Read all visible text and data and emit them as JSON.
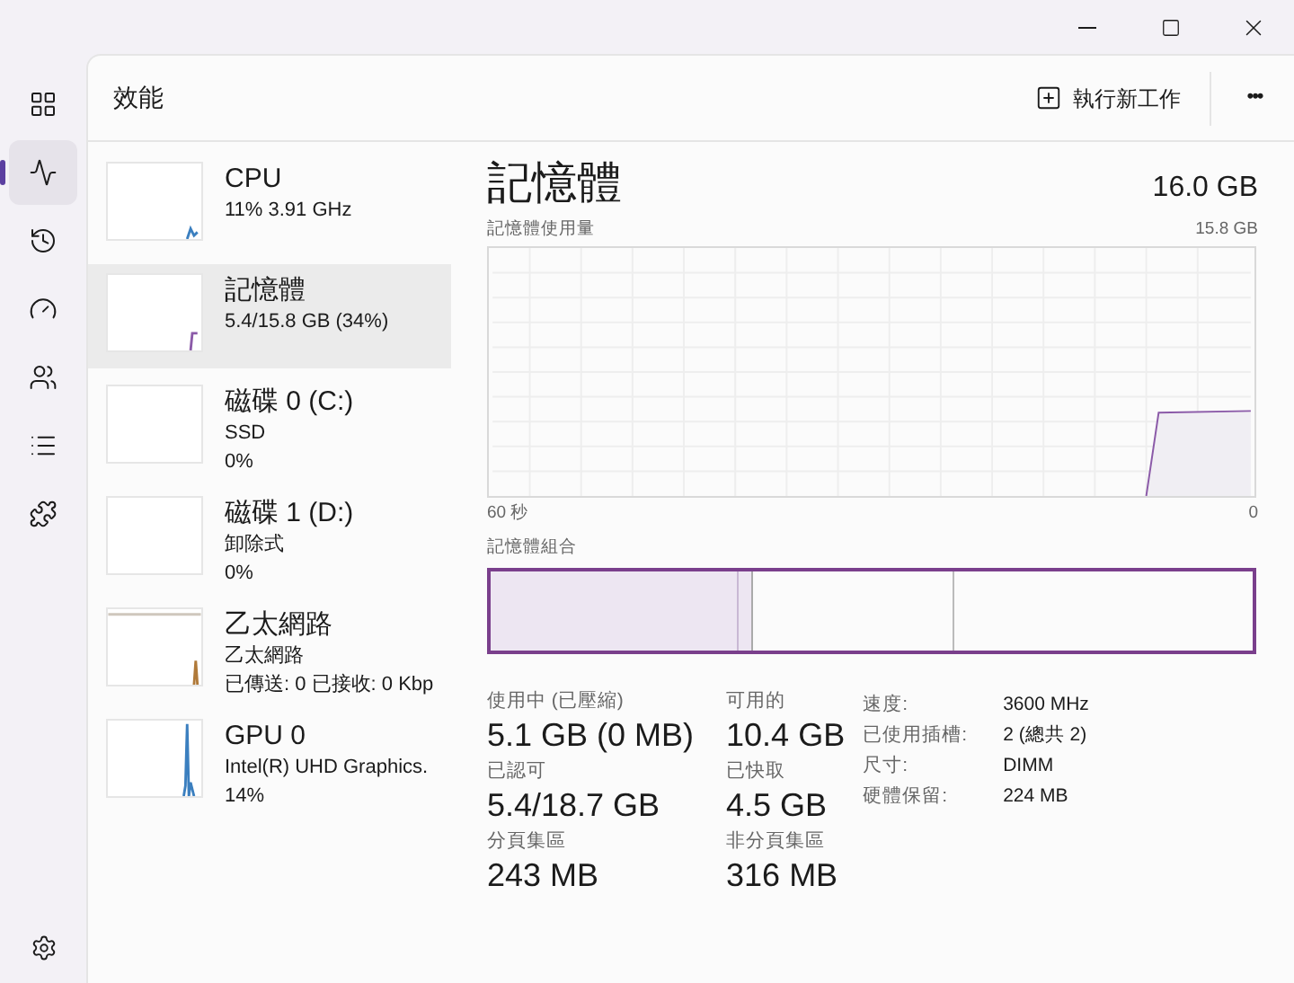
{
  "nav": [
    {
      "kind": "processes",
      "selected": false
    },
    {
      "kind": "performance",
      "selected": true
    },
    {
      "kind": "history",
      "selected": false
    },
    {
      "kind": "startup",
      "selected": false
    },
    {
      "kind": "users",
      "selected": false
    },
    {
      "kind": "details",
      "selected": false
    },
    {
      "kind": "services",
      "selected": false
    }
  ],
  "header": {
    "title": "效能",
    "run_task": "執行新工作",
    "more": "•••"
  },
  "devices": [
    {
      "name": "CPU",
      "lines": [
        "11%  3.91 GHz"
      ],
      "selected": false,
      "color": "#3b7fbf"
    },
    {
      "name": "記憶體",
      "lines": [
        "5.4/15.8 GB (34%)"
      ],
      "selected": true,
      "color": "#8b5aa8"
    },
    {
      "name": "磁碟 0 (C:)",
      "lines": [
        "SSD",
        "0%"
      ],
      "selected": false
    },
    {
      "name": "磁碟 1 (D:)",
      "lines": [
        "卸除式",
        "0%"
      ],
      "selected": false
    },
    {
      "name": "乙太網路",
      "lines": [
        "乙太網路",
        "已傳送: 0 已接收: 0 Kbp"
      ],
      "selected": false,
      "color": "#b07a3a"
    },
    {
      "name": "GPU 0",
      "lines": [
        "Intel(R) UHD Graphics.",
        "14%"
      ],
      "selected": false,
      "color": "#3b7fbf"
    }
  ],
  "detail": {
    "title": "記憶體",
    "total": "16.0 GB",
    "usage_label": "記憶體使用量",
    "usage_max": "15.8 GB",
    "time_start": "60 秒",
    "time_end": "0",
    "composition_label": "記憶體組合",
    "stats": [
      {
        "label": "使用中 (已壓縮)",
        "value": "5.1 GB (0 MB)"
      },
      {
        "label": "可用的",
        "value": "10.4 GB"
      },
      {
        "label": "已認可",
        "value": "5.4/18.7 GB"
      },
      {
        "label": "已快取",
        "value": "4.5 GB"
      },
      {
        "label": "分頁集區",
        "value": "243 MB"
      },
      {
        "label": "非分頁集區",
        "value": "316 MB"
      }
    ],
    "properties": [
      {
        "label": "速度:",
        "value": "3600 MHz"
      },
      {
        "label": "已使用插槽:",
        "value": "2 (總共 2)"
      },
      {
        "label": "尺寸:",
        "value": "DIMM"
      },
      {
        "label": "硬體保留:",
        "value": "224 MB"
      }
    ]
  }
}
